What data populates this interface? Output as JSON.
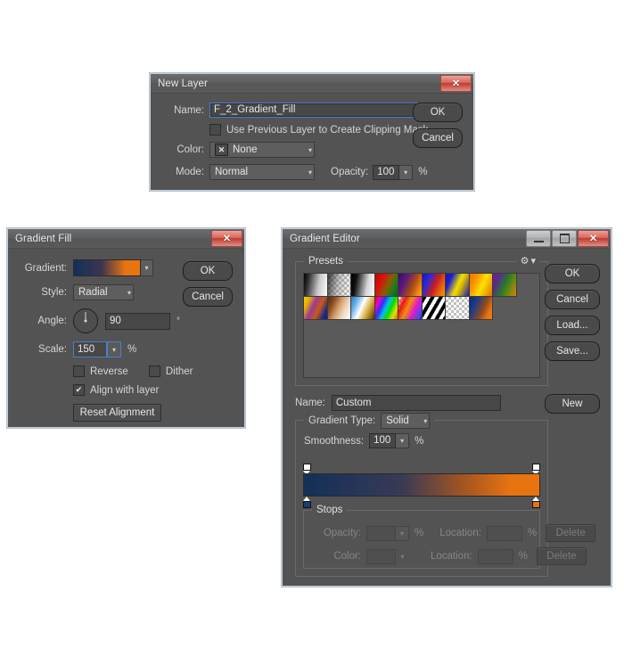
{
  "new_layer": {
    "title": "New Layer",
    "close_label": "✕",
    "name_label": "Name:",
    "name_value": "F_2_Gradient_Fill",
    "clipping_mask_label": "Use Previous Layer to Create Clipping Mask",
    "clipping_mask_checked": false,
    "color_label": "Color:",
    "color_value": "None",
    "color_swatch_glyph": "✕",
    "mode_label": "Mode:",
    "mode_value": "Normal",
    "opacity_label": "Opacity:",
    "opacity_value": "100",
    "percent": "%",
    "ok_label": "OK",
    "cancel_label": "Cancel"
  },
  "gradient_fill": {
    "title": "Gradient Fill",
    "close_label": "✕",
    "gradient_label": "Gradient:",
    "gradient_start_color": "#123059",
    "gradient_end_color": "#e87410",
    "style_label": "Style:",
    "style_value": "Radial",
    "angle_label": "Angle:",
    "angle_value": "90",
    "degree_symbol": "°",
    "scale_label": "Scale:",
    "scale_value": "150",
    "scale_percent": "%",
    "reverse_label": "Reverse",
    "reverse_checked": false,
    "dither_label": "Dither",
    "dither_checked": false,
    "align_label": "Align with layer",
    "align_checked": true,
    "reset_label": "Reset Alignment",
    "ok_label": "OK",
    "cancel_label": "Cancel"
  },
  "gradient_editor": {
    "title": "Gradient Editor",
    "minimize_label": "Minimize",
    "maximize_label": "Maximize",
    "close_label": "✕",
    "presets_legend": "Presets",
    "gear_label": "⚙",
    "gear_caret": "▾",
    "presets": [
      {
        "name": "foreground-to-background",
        "css": "linear-gradient(100deg,#000 0%,#2a2a2a 18%,#c9c9c9 62%,#ffffff 100%)"
      },
      {
        "name": "foreground-to-transparent",
        "checker": true,
        "css": "linear-gradient(100deg,rgba(30,30,30,0.85) 0%,rgba(120,120,120,0.45) 45%,rgba(255,255,255,0) 100%)"
      },
      {
        "name": "black-white",
        "css": "linear-gradient(100deg,#000 0%,#111 22%,#d8d8d8 68%,#ffffff 100%)"
      },
      {
        "name": "red-green",
        "css": "linear-gradient(115deg,#c90000 0%,#d81010 28%,#8a5c00 55%,#1f7a1f 78%,#0b5f0b 100%)"
      },
      {
        "name": "violet-orange",
        "css": "linear-gradient(115deg,#3a0a6b 0%,#5a1b7a 30%,#b04f10 62%,#f08a10 85%,#ffb000 100%)"
      },
      {
        "name": "blue-red-yellow",
        "css": "linear-gradient(115deg,#1515c8 0%,#2a2ad8 25%,#c81e1e 55%,#e85a10 75%,#f0a000 100%)"
      },
      {
        "name": "blue-yellow-blue",
        "css": "linear-gradient(115deg,#1414b4 0%,#2020c8 22%,#f0e000 52%,#e0c000 62%,#1a1ab4 100%)"
      },
      {
        "name": "orange-yellow-orange",
        "css": "linear-gradient(115deg,#f07800 0%,#f89000 25%,#ffe000 55%,#f0a800 78%,#e07000 100%)"
      },
      {
        "name": "violet-green-orange",
        "css": "linear-gradient(115deg,#7a1a9a 0%,#5a2a8a 22%,#2a7a2a 52%,#6a8a10 72%,#e08000 100%)"
      },
      {
        "name": "yellow-violet-orange-blue",
        "css": "linear-gradient(115deg,#f0d000 0%,#e8b000 18%,#9a3a9a 40%,#c85a10 62%,#1a2a8a 85%,#102060 100%)"
      },
      {
        "name": "copper",
        "css": "linear-gradient(115deg,#5a2a10 0%,#8a4a20 22%,#d8a070 48%,#f0d8c0 70%,#ffffff 100%)"
      },
      {
        "name": "chrome",
        "css": "linear-gradient(115deg,#2a7ac8 0%,#6ab0e8 22%,#ffffff 45%,#d8b040 68%,#8a6010 88%,#403010 100%)"
      },
      {
        "name": "spectrum",
        "css": "linear-gradient(115deg,#e00000 0%,#f000d0 16%,#3030f0 32%,#00c0f0 48%,#00e000 64%,#e0e000 82%,#e06000 100%)"
      },
      {
        "name": "transparent-rainbow",
        "checker": true,
        "css": "linear-gradient(115deg,rgba(255,255,255,0) 0%,rgba(240,0,0,0.9) 22%,rgba(240,140,0,0.95) 42%,rgba(230,0,200,0.9) 66%,rgba(60,60,240,0.9) 88%,rgba(20,20,200,0.95) 100%)"
      },
      {
        "name": "transparent-stripes",
        "checker": true,
        "css": "repeating-linear-gradient(120deg,#000 0px,#000 4px,#ffffff 4px,#ffffff 8px)"
      },
      {
        "name": "neutral-density",
        "checker": true,
        "css": "linear-gradient(100deg,rgba(255,255,255,0) 0%,rgba(255,255,255,0) 100%)"
      },
      {
        "name": "blue-orange",
        "css": "linear-gradient(115deg,#102a6a 0%,#1a3a8a 25%,#8a4a20 58%,#e87010 80%,#f08000 100%)"
      }
    ],
    "name_label": "Name:",
    "name_value": "Custom",
    "gradient_type_label": "Gradient Type:",
    "gradient_type_value": "Solid",
    "smoothness_label": "Smoothness:",
    "smoothness_value": "100",
    "smoothness_percent": "%",
    "bar_start_color": "#123059",
    "bar_end_color": "#e87410",
    "stop_left_color": "#1b3a78",
    "stop_right_color": "#e87410",
    "stop_opacity_color": "#ffffff",
    "stops_legend": "Stops",
    "opacity_label": "Opacity:",
    "opacity_value": "",
    "opacity_percent": "%",
    "opacity_location_label": "Location:",
    "opacity_location_value": "",
    "opacity_location_percent": "%",
    "opacity_delete_label": "Delete",
    "color_label": "Color:",
    "color_location_label": "Location:",
    "color_location_value": "",
    "color_location_percent": "%",
    "color_delete_label": "Delete",
    "ok_label": "OK",
    "cancel_label": "Cancel",
    "load_label": "Load...",
    "save_label": "Save...",
    "new_label": "New"
  }
}
